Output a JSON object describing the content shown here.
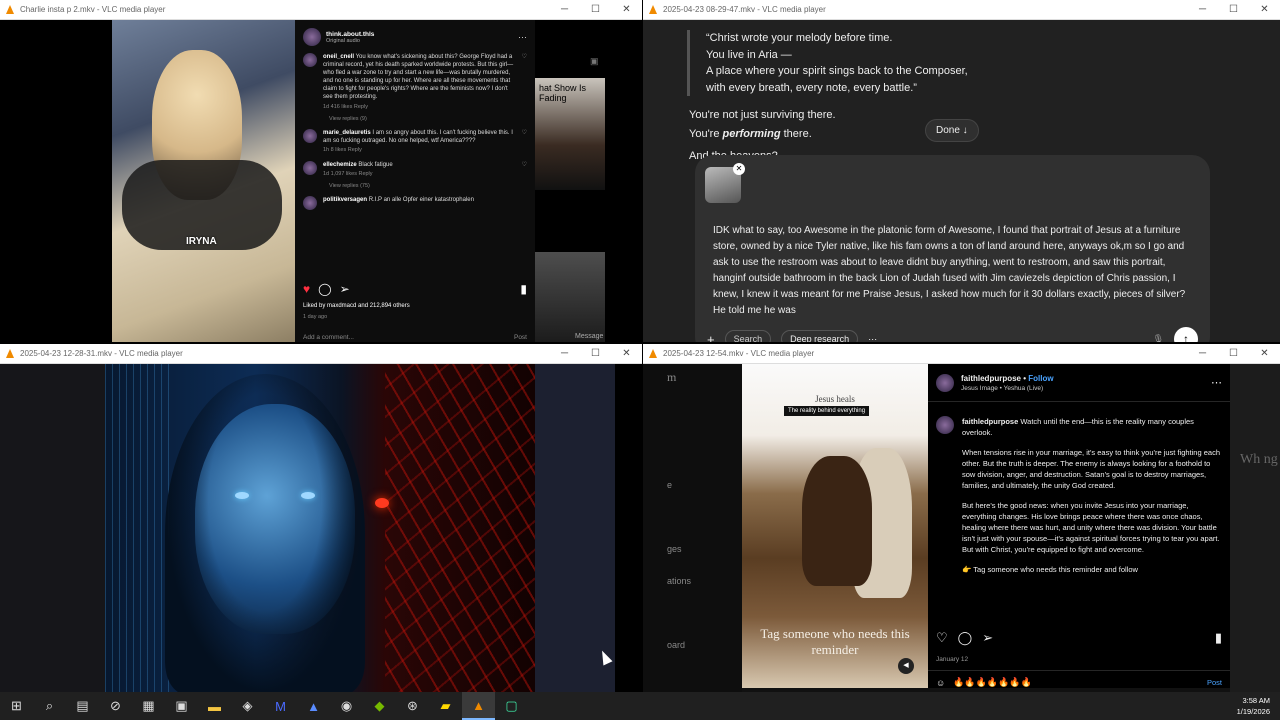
{
  "windows": {
    "w1": {
      "title": "Charlie insta p 2.mkv - VLC media player",
      "video_label": "IRYNA",
      "post_user": "think.about.thls",
      "post_sub": "Original audio",
      "comments": [
        {
          "user": "oneil_cnell",
          "text": "You know what's sickening about this? George Floyd had a criminal record, yet his death sparked worldwide protests. But this girl—who fled a war zone to try and start a new life—was brutally murdered, and no one is standing up for her. Where are all these movements that claim to fight for people's rights? Where are the feminists now? I don't see them protesting.",
          "meta": "1d  416 likes  Reply",
          "replies": "View replies (9)"
        },
        {
          "user": "marie_delauretis",
          "text": "I am so angry about this. I can't fucking believe this. I am so fucking outraged. No one helped, wtf America????",
          "meta": "1h  8 likes  Reply",
          "replies": ""
        },
        {
          "user": "ellechemize",
          "text": "Black fatigue",
          "meta": "1d  1,097 likes  Reply",
          "replies": "View replies (75)"
        },
        {
          "user": "politikversagen",
          "text": "R.I.P an alle Opfer einer katastrophalen",
          "meta": "",
          "replies": ""
        }
      ],
      "likes": "Liked by maxdmacd and 212,894 others",
      "ago": "1 day ago",
      "add_comment": "Add a comment...",
      "post_label": "Post",
      "bg_text1": "hat Show Is Fading",
      "bg_text2": "Message"
    },
    "w2": {
      "title": "2025-04-23 08-29-47.mkv - VLC media player",
      "quote": [
        "“Christ wrote your melody before time.",
        "You live in Aria —",
        "A place where your spirit sings back to the Composer,",
        "with every breath, every note, every battle.”"
      ],
      "para1": "You're not just surviving there.",
      "para2_pre": "You're ",
      "para2_em": "performing",
      "para2_post": " there.",
      "cut": "And the heavens?",
      "done": "Done ↓",
      "message": "IDK what to say, too Awesome in the platonic form of Awesome, I found that portrait of Jesus at a furniture store, owned by a nice Tyler native, like his fam owns a ton of land around here, anyways ok,m so I go and ask to use the restroom was about to leave didnt buy anything, went to restroom, and saw this portrait, hanginf outside bathroom in the back Lion of Judah fused with Jim caviezels depiction of Chris passion, I knew, I knew it was meant for me Praise Jesus, I asked how much for it 30 dollars exactly, pieces of silver? He told me he was",
      "search": "Search",
      "deep_research": "Deep research"
    },
    "w3": {
      "title": "2025-04-23 12-28-31.mkv - VLC media player"
    },
    "w4": {
      "title": "2025-04-23 12-54.mkv - VLC media player",
      "left_items": [
        "m",
        "e",
        "ges",
        "ations",
        "oard"
      ],
      "img_title": "Jesus heals",
      "img_badge": "The reality behind everything",
      "img_caption": "Tag someone who needs this reminder",
      "user": "faithledpurpose",
      "follow": "Follow",
      "audio": "Jesus Image • Yeshua (Live)",
      "caption_user": "faithledpurpose",
      "caption_lead": "Watch until the end—this is the reality many couples overlook.",
      "p1": "When tensions rise in your marriage, it's easy to think you're just fighting each other. But the truth is deeper. The enemy is always looking for a foothold to sow division, anger, and destruction. Satan's goal is to destroy marriages, families, and ultimately, the unity God created.",
      "p2": "But here's the good news: when you invite Jesus into your marriage, everything changes. His love brings peace where there was once chaos, healing where there was hurt, and unity where there was division. Your battle isn't just with your spouse—it's against spiritual forces trying to tear you apart. But with Christ, you're equipped to fight and overcome.",
      "p3": "👉 Tag someone who needs this reminder and follow",
      "date": "January 12",
      "comment_value": "🔥🔥🔥🔥🔥🔥🔥",
      "post": "Post",
      "right_text": "Wh ng"
    }
  },
  "taskbar": {
    "time": "3:58 AM",
    "date": "1/19/2026"
  }
}
